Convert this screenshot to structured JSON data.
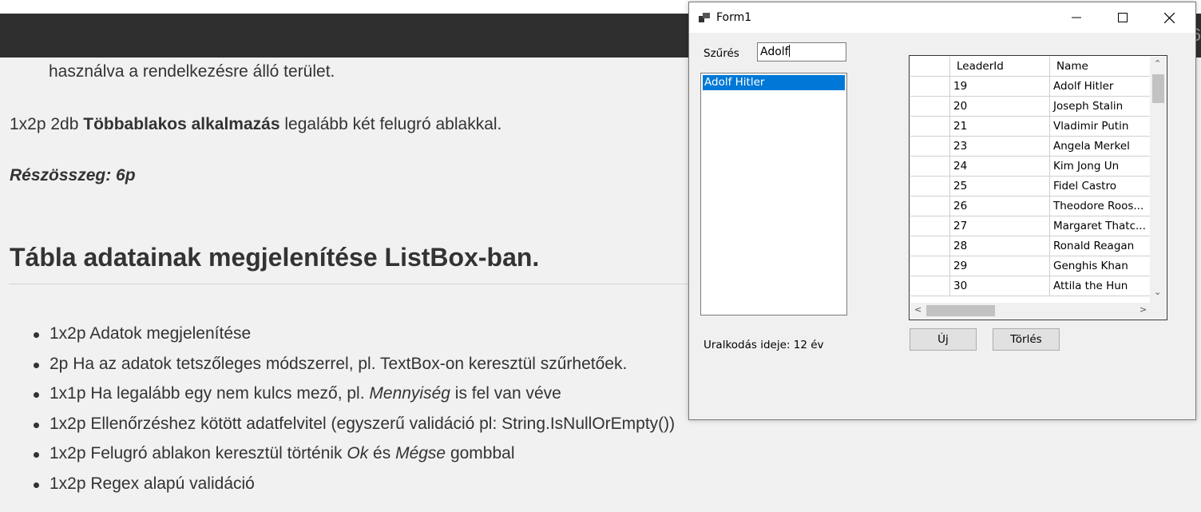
{
  "page": {
    "para1": "használva a rendelkezésre álló terület.",
    "para2_pre": "1x2p 2db ",
    "para2_bold": "Többablakos alkalmazás",
    "para2_post": " legalább két felugró ablakkal.",
    "subtotal": "Részösszeg: 6p",
    "heading": "Tábla adatainak megjelenítése ListBox-ban.",
    "bullets": [
      "1x2p Adatok megjelenítése",
      "2p Ha az adatok tetszőleges módszerrel, pl. TextBox-on keresztül szűrhetőek.",
      "1x1p Ha legalább egy nem kulcs mező, pl. Mennyiség is fel van véve",
      "1x2p Ellenőrzéshez kötött adatfelvitel (egyszerű validáció pl: String.IsNullOrEmpty())",
      "1x2p Felugró ablakon keresztül történik Ok és Mégse gombbal",
      "1x2p Regex alapú validáció"
    ],
    "bullet3_parts": [
      "1x1p Ha legalább egy nem kulcs mező, pl. ",
      "Mennyiség",
      " is fel van véve"
    ],
    "bullet5_parts": [
      "1x2p Felugró ablakon keresztül történik ",
      "Ok",
      " és ",
      "Mégse",
      " gombbal"
    ]
  },
  "window": {
    "title": "Form1",
    "filter_label": "Szűrés",
    "filter_value": "Adolf",
    "listbox_items": [
      "Adolf Hitler"
    ],
    "rule_label": "Uralkodás ideje: 12 év",
    "new_button": "Új",
    "delete_button": "Törlés",
    "grid": {
      "columns": [
        "LeaderId",
        "Name"
      ],
      "rows": [
        [
          "19",
          "Adolf Hitler"
        ],
        [
          "20",
          "Joseph Stalin"
        ],
        [
          "21",
          "Vladimir Putin"
        ],
        [
          "23",
          "Angela Merkel"
        ],
        [
          "24",
          "Kim Jong Un"
        ],
        [
          "25",
          "Fidel Castro"
        ],
        [
          "26",
          "Theodore Roos..."
        ],
        [
          "27",
          "Margaret Thatc..."
        ],
        [
          "28",
          "Ronald Reagan"
        ],
        [
          "29",
          "Genghis Khan"
        ],
        [
          "30",
          "Attila the Hun"
        ]
      ]
    }
  }
}
